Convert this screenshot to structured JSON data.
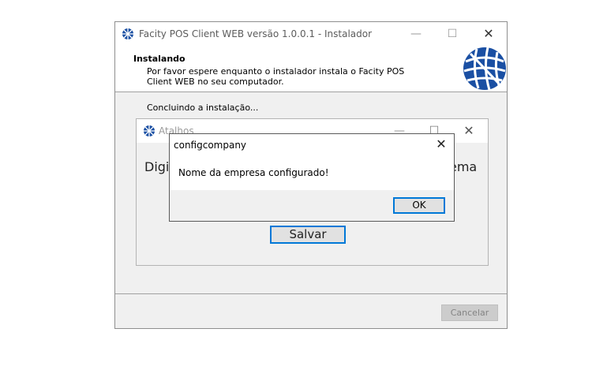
{
  "installer": {
    "title": "Facity POS Client WEB versão 1.0.0.1 - Instalador",
    "heading": "Instalando",
    "description": "Por favor espere enquanto o instalador instala o Facity POS Client WEB no seu computador.",
    "status": "Concluindo a instalação...",
    "cancel_label": "Cancelar",
    "min_glyph": "—",
    "max_glyph": "☐",
    "close_glyph": "✕"
  },
  "atalhos": {
    "title": "Atalhos",
    "text_left": "Digit",
    "text_right": "ema",
    "save_label": "Salvar",
    "min_glyph": "—",
    "max_glyph": "☐",
    "close_glyph": "✕"
  },
  "message_box": {
    "title": "configcompany",
    "message": "Nome da empresa configurado!",
    "ok_label": "OK",
    "close_glyph": "✕"
  },
  "colors": {
    "accent": "#0078d7",
    "logo_blue": "#1a4fa3"
  },
  "icons": {
    "app_icon": "globe-grid-icon",
    "logo": "globe-grid-logo"
  }
}
